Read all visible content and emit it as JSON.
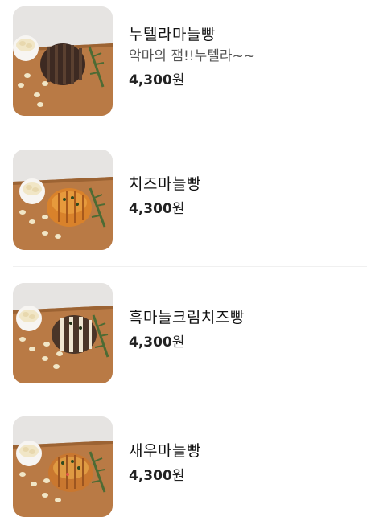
{
  "menu": {
    "items": [
      {
        "name": "누텔라마늘빵",
        "description": "악마의 잼!!누텔라~~",
        "price": "4,300",
        "currency": "원",
        "image": "nutella-garlic-bread-photo",
        "bread_color": "#3d2a22"
      },
      {
        "name": "치즈마늘빵",
        "description": "",
        "price": "4,300",
        "currency": "원",
        "image": "cheese-garlic-bread-photo",
        "bread_color": "#d9822b"
      },
      {
        "name": "흑마늘크림치즈빵",
        "description": "",
        "price": "4,300",
        "currency": "원",
        "image": "black-garlic-cream-cheese-bread-photo",
        "bread_color": "#4a3528"
      },
      {
        "name": "새우마늘빵",
        "description": "",
        "price": "4,300",
        "currency": "원",
        "image": "shrimp-garlic-bread-photo",
        "bread_color": "#c9772f"
      }
    ]
  },
  "colors": {
    "board": "#b97a45",
    "board_dark": "#9c6333",
    "backdrop": "#e6e4e2",
    "garlic": "#f1e6c6",
    "herb": "#4d6b34"
  }
}
